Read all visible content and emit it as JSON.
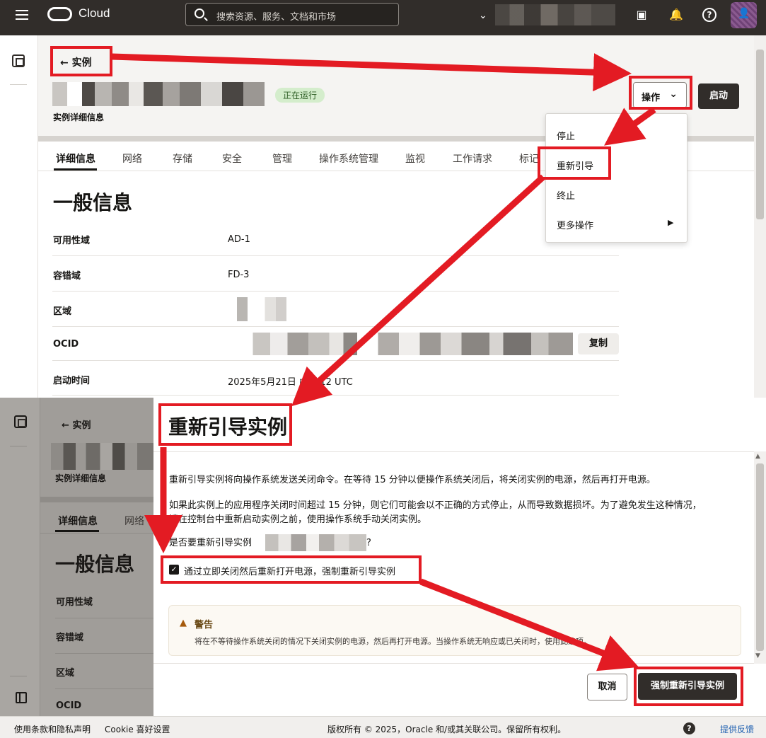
{
  "topbar": {
    "logo_text": "Cloud",
    "search_placeholder": "搜索资源、服务、文档和市场"
  },
  "page": {
    "back_label": "实例",
    "status": "正在运行",
    "subtitle": "实例详细信息",
    "actions_label": "操作",
    "start_label": "启动"
  },
  "tabs": [
    "详细信息",
    "网络",
    "存储",
    "安全",
    "管理",
    "操作系统管理",
    "监视",
    "工作请求",
    "标记"
  ],
  "general_info": {
    "title": "一般信息",
    "rows": [
      {
        "label": "可用性域",
        "value": "AD-1"
      },
      {
        "label": "容错域",
        "value": "FD-3"
      },
      {
        "label": "区域",
        "value": ""
      },
      {
        "label": "OCID",
        "value": ""
      },
      {
        "label": "启动时间",
        "value": "2025年5月21日 □:4:12 UTC"
      }
    ],
    "copy_label": "复制"
  },
  "actions_menu": {
    "items": [
      "停止",
      "重新引导",
      "终止",
      "更多操作"
    ]
  },
  "lower_background": {
    "back_label": "实例",
    "subtitle": "实例详细信息",
    "tabs": [
      "详细信息",
      "网络"
    ],
    "title": "一般信息",
    "labels": [
      "可用性域",
      "容错域",
      "区域",
      "OCID"
    ]
  },
  "dialog": {
    "title": "重新引导实例",
    "paragraph1": "重新引导实例将向操作系统发送关闭命令。在等待 15 分钟以便操作系统关闭后，将关闭实例的电源，然后再打开电源。",
    "paragraph2_line1": "如果此实例上的应用程序关闭时间超过 15 分钟，则它们可能会以不正确的方式停止，从而导致数据损坏。为了避免发生这种情况，",
    "paragraph2_line2": "请在控制台中重新启动实例之前，使用操作系统手动关闭实例。",
    "question_prefix": "是否要重新引导实例",
    "question_suffix": "?",
    "checkbox_label": "通过立即关闭然后重新打开电源，强制重新引导实例",
    "checkbox_checked": true,
    "warning_title": "警告",
    "warning_text": "将在不等待操作系统关闭的情况下关闭实例的电源，然后再打开电源。当操作系统无响应或已关闭时，使用此选项。",
    "cancel_label": "取消",
    "confirm_label": "强制重新引导实例"
  },
  "footer": {
    "terms": "使用条款和隐私声明",
    "cookie": "Cookie 喜好设置",
    "copyright": "版权所有 © 2025，Oracle 和/或其关联公司。保留所有权利。",
    "help": "?",
    "feedback": "提供反馈"
  },
  "colors": {
    "topbar": "#312d2a",
    "annotation_red": "#e31b23",
    "status_green_bg": "#d4edcc",
    "primary_button": "#312d2a",
    "link_blue": "#1c5eb0"
  }
}
